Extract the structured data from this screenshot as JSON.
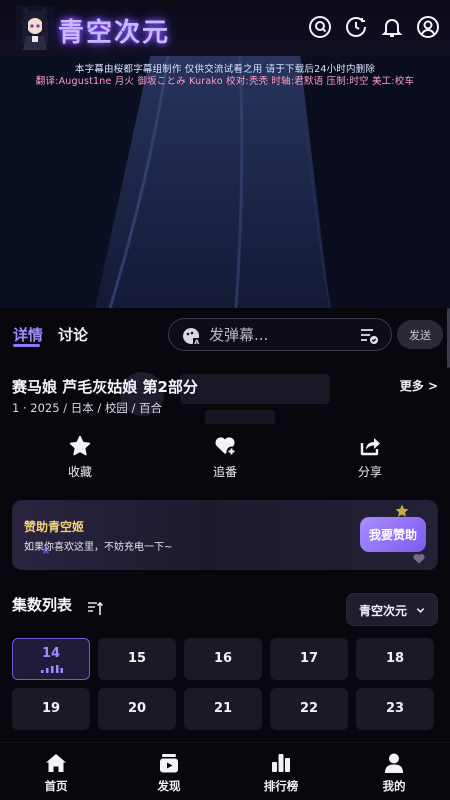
{
  "header": {
    "brand": "青空次元",
    "icons": [
      "search-icon",
      "history-icon",
      "bell-icon",
      "user-icon"
    ]
  },
  "video": {
    "subtitle_line1": "本字幕由桜都字幕组制作  仅供交流试看之用  请于下载后24小时内删除",
    "subtitle_line2": "翻译:August1ne 月火 御坂ことみ Kurako 校对:秃秃 时轴:君默语 压制:时空 美工:校车"
  },
  "tabs": [
    {
      "label": "详情",
      "active": true
    },
    {
      "label": "讨论",
      "active": false
    }
  ],
  "danmaku": {
    "placeholder": "发弹幕...",
    "send_label": "发送"
  },
  "details": {
    "title": "赛马娘 芦毛灰姑娘 第2部分",
    "more_label": "更多 >",
    "meta": "1 · 2025 / 日本 / 校园 / 百合"
  },
  "actions": [
    {
      "label": "收藏",
      "icon": "star-icon"
    },
    {
      "label": "追番",
      "icon": "heart-add-icon"
    },
    {
      "label": "分享",
      "icon": "share-icon"
    }
  ],
  "sponsor": {
    "title": "赞助青空姬",
    "desc": "如果你喜欢这里，不妨充电一下~",
    "button": "我要赞助"
  },
  "episodes": {
    "heading": "集数列表",
    "source": "青空次元",
    "list": [
      "14",
      "15",
      "16",
      "17",
      "18",
      "19",
      "20",
      "21",
      "22",
      "23"
    ],
    "active": "14"
  },
  "bottom_nav": [
    {
      "label": "首页",
      "icon": "home-icon"
    },
    {
      "label": "发现",
      "icon": "discover-icon"
    },
    {
      "label": "排行榜",
      "icon": "ranking-icon"
    },
    {
      "label": "我的",
      "icon": "profile-icon"
    }
  ],
  "colors": {
    "accent": "#9f8cff",
    "background": "#07070d",
    "card": "#1a1a24",
    "gold": "#f3d27a"
  }
}
